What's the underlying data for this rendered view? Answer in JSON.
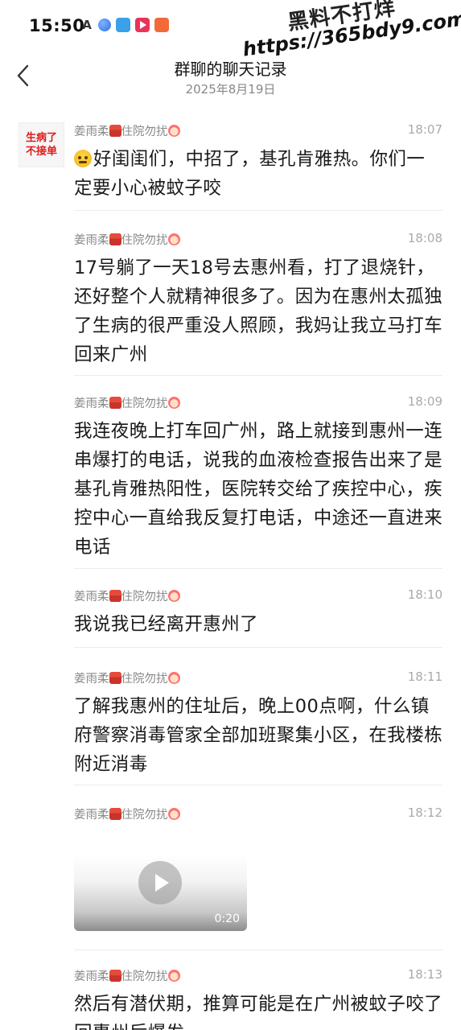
{
  "status_bar": {
    "time": "15:50",
    "a_icon": "A",
    "icons": [
      "auto-icon",
      "blue-app-icon",
      "book-app-icon",
      "video-app-icon",
      "shield-app-icon"
    ]
  },
  "watermark": {
    "text": "黑料不打烊",
    "url": "https://365bdy9.com"
  },
  "header": {
    "title": "群聊的聊天记录",
    "date": "2025年8月19日",
    "back_icon": "chevron-left-icon"
  },
  "avatar": {
    "line1": "生病了",
    "line2": "不接单",
    "color": "#e01919"
  },
  "messages": [
    {
      "sender": "姜雨柔",
      "sender_suffix": "住院勿扰",
      "time": "18:07",
      "text": "好闺闺们，中招了，基孔肯雅热。你们一定要小心被蚊子咬",
      "leading_emoji": "face-emoji"
    },
    {
      "sender": "姜雨柔",
      "sender_suffix": "住院勿扰",
      "time": "18:08",
      "text": "17号躺了一天18号去惠州看，打了退烧针，还好整个人就精神很多了。因为在惠州太孤独了生病的很严重没人照顾，我妈让我立马打车回来广州"
    },
    {
      "sender": "姜雨柔",
      "sender_suffix": "住院勿扰",
      "time": "18:09",
      "text": "我连夜晚上打车回广州，路上就接到惠州一连串爆打的电话，说我的血液检查报告出来了是基孔肯雅热阳性，医院转交给了疾控中心，疾控中心一直给我反复打电话，中途还一直进来电话"
    },
    {
      "sender": "姜雨柔",
      "sender_suffix": "住院勿扰",
      "time": "18:10",
      "text": "我说我已经离开惠州了"
    },
    {
      "sender": "姜雨柔",
      "sender_suffix": "住院勿扰",
      "time": "18:11",
      "text": "了解我惠州的住址后，晚上00点啊，什么镇府警察消毒管家全部加班聚集小区，在我楼栋附近消毒"
    },
    {
      "sender": "姜雨柔",
      "sender_suffix": "住院勿扰",
      "time": "18:12",
      "video_duration": "0:20"
    },
    {
      "sender": "姜雨柔",
      "sender_suffix": "住院勿扰",
      "time": "18:13",
      "text": "然后有潜伏期，推算可能是在广州被蚊子咬了回惠州后爆发"
    }
  ]
}
